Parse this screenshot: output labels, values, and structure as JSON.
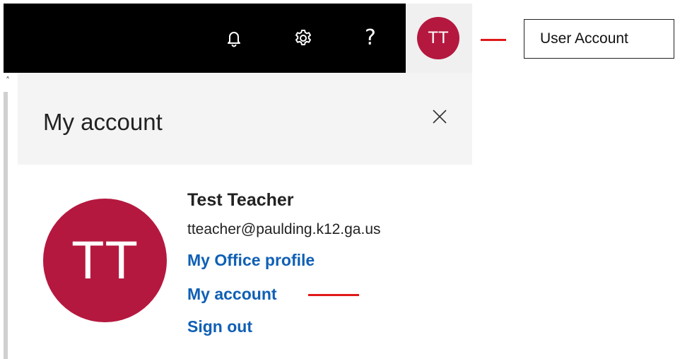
{
  "topbar": {
    "icons": [
      "bell-icon",
      "gear-icon",
      "help-icon"
    ],
    "help_glyph": "?",
    "avatar_initials": "TT",
    "avatar_color": "#b5183f",
    "background": "#000000"
  },
  "panel": {
    "title": "My account",
    "close_icon": "close-icon",
    "user": {
      "initials": "TT",
      "name": "Test Teacher",
      "email": "tteacher@paulding.k12.ga.us"
    },
    "links": {
      "office_profile": "My Office profile",
      "my_account": "My account",
      "sign_out": "Sign out"
    },
    "link_color": "#0f5fb5"
  },
  "annotation": {
    "callout_text": "User Account",
    "line_color": "#e01818"
  }
}
